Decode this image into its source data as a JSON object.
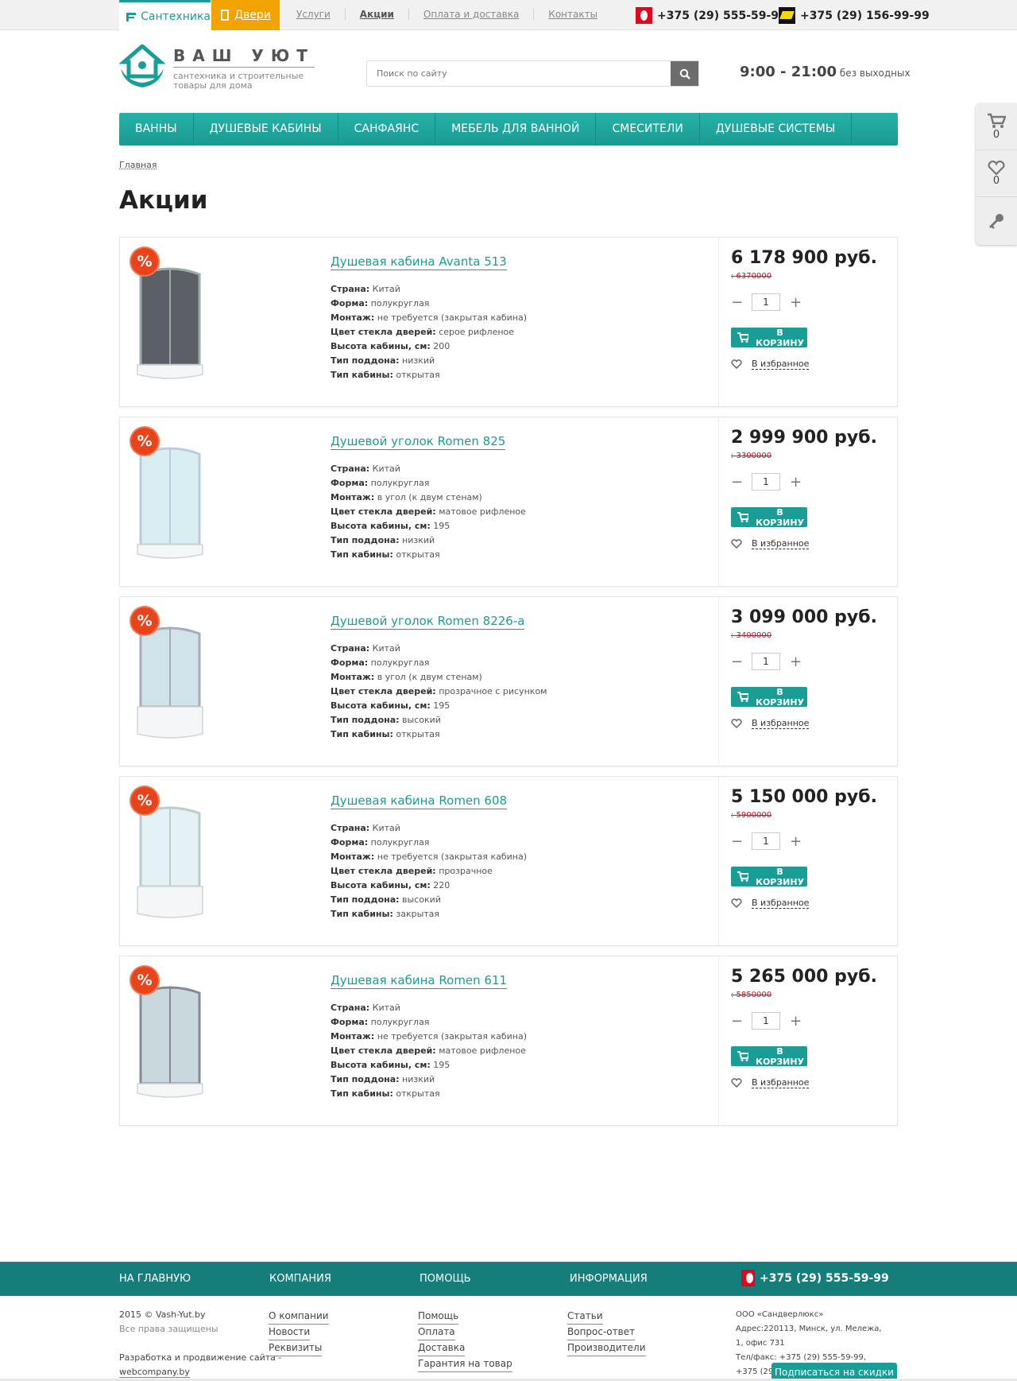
{
  "topbar": {
    "tab_santeh": "Сантехника",
    "tab_doors": "Двери",
    "nav": [
      {
        "label": "Услуги",
        "active": false
      },
      {
        "label": "Акции",
        "active": true
      },
      {
        "label": "Оплата и доставка",
        "active": false
      },
      {
        "label": "Контакты",
        "active": false
      }
    ],
    "phone1": "+375 (29) 555-59-99",
    "phone2": "+375 (29) 156-99-99"
  },
  "header": {
    "logo_title": "ВАШ УЮТ",
    "logo_sub": "сантехника и строительные товары для дома",
    "search_placeholder": "Поиск по сайту",
    "hours": "9:00 - 21:00",
    "hours_note": "без выходных"
  },
  "mainnav": [
    "ВАННЫ",
    "ДУШЕВЫЕ КАБИНЫ",
    "САНФАЯНС",
    "МЕБЕЛЬ ДЛЯ ВАННОЙ",
    "СМЕСИТЕЛИ",
    "ДУШЕВЫЕ СИСТЕМЫ"
  ],
  "breadcrumb": "Главная",
  "page_title": "Акции",
  "side_tools": {
    "cart_count": "0",
    "fav_count": "0"
  },
  "labels": {
    "country": "Страна:",
    "shape": "Форма:",
    "mount": "Монтаж:",
    "glass": "Цвет стекла дверей:",
    "height": "Высота кабины, см:",
    "tray": "Тип поддона:",
    "type": "Тип кабины:",
    "add_to_cart": "В КОРЗИНУ",
    "to_favorites": "В избранное",
    "sale_badge": "%"
  },
  "products": [
    {
      "name": "Душевая кабина Avanta 513",
      "country": "Китай",
      "shape": "полукруглая",
      "mount": "не требуется (закрытая кабина)",
      "glass": "серое рифленое",
      "height": "200",
      "tray": "низкий",
      "type": "открытая",
      "price": "6 178 900 руб.",
      "old_price": ": 6370000",
      "qty": "1"
    },
    {
      "name": "Душевой уголок Romen 825",
      "country": "Китай",
      "shape": "полукруглая",
      "mount": "в угол (к двум стенам)",
      "glass": "матовое рифленое",
      "height": "195",
      "tray": "низкий",
      "type": "открытая",
      "price": "2 999 900 руб.",
      "old_price": ": 3300000",
      "qty": "1"
    },
    {
      "name": "Душевой уголок Romen 8226-a",
      "country": "Китай",
      "shape": "полукруглая",
      "mount": "в угол (к двум стенам)",
      "glass": "прозрачное с рисунком",
      "height": "195",
      "tray": "высокий",
      "type": "открытая",
      "price": "3 099 000 руб.",
      "old_price": ": 3400000",
      "qty": "1"
    },
    {
      "name": "Душевая кабина Romen 608",
      "country": "Китай",
      "shape": "полукруглая",
      "mount": "не требуется (закрытая кабина)",
      "glass": "прозрачное",
      "height": "220",
      "tray": "высокий",
      "type": "закрытая",
      "price": "5 150 000 руб.",
      "old_price": ": 5900000",
      "qty": "1"
    },
    {
      "name": "Душевая кабина Romen 611",
      "country": "Китай",
      "shape": "полукруглая",
      "mount": "не требуется (закрытая кабина)",
      "glass": "матовое рифленое",
      "height": "195",
      "tray": "низкий",
      "type": "открытая",
      "price": "5 265 000 руб.",
      "old_price": ": 5850000",
      "qty": "1"
    }
  ],
  "footer": {
    "heads": [
      "НА ГЛАВНУЮ",
      "КОМПАНИЯ",
      "ПОМОЩЬ",
      "ИНФОРМАЦИЯ"
    ],
    "phone": "+375 (29) 555-59-99",
    "copyright": "2015 © Vash-Yut.by",
    "rights": "Все права защищены",
    "dev": "Разработка и продвижение сайта -",
    "dev_link": "webcompany.by",
    "company_links": [
      "О компании",
      "Новости",
      "Реквизиты"
    ],
    "help_links": [
      "Помощь",
      "Оплата",
      "Доставка",
      "Гарантия на товар"
    ],
    "info_links": [
      "Статьи",
      "Вопрос-ответ",
      "Производители"
    ],
    "company_name": "ООО «Сандверлюкс»",
    "address": "Адрес:220113, Минск, ул. Мележа, 1, офис 731",
    "tel": "Тел/факс: +375 (29) 555-59-99, +375 (29) 156-",
    "subscribe": "Подписаться на скидки"
  },
  "colors": {
    "accent": "#1a9d95",
    "doors": "#f3a300",
    "sale": "#e8431a",
    "old_price": "#e3051b",
    "footer": "#167e7a"
  }
}
